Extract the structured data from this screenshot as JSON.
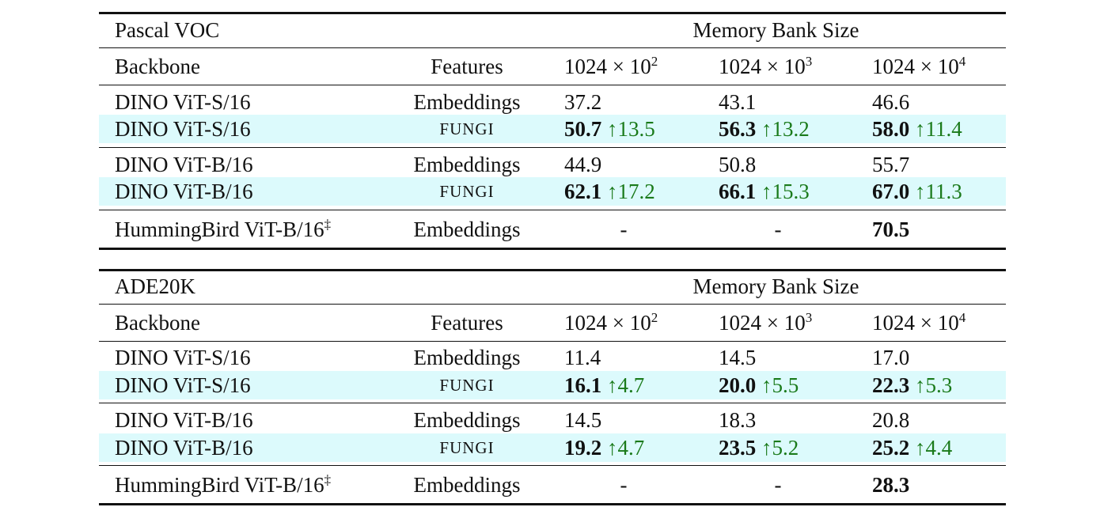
{
  "tables": [
    {
      "dataset": "Pascal VOC",
      "group_header": "Memory Bank Size",
      "columns": {
        "backbone": "Backbone",
        "features": "Features",
        "sizes": [
          {
            "base": "1024 × 10",
            "exp": "2"
          },
          {
            "base": "1024 × 10",
            "exp": "3"
          },
          {
            "base": "1024 × 10",
            "exp": "4"
          }
        ]
      },
      "rows": [
        {
          "backbone": "DINO ViT-S/16",
          "features": "Embeddings",
          "values": [
            "37.2",
            "43.1",
            "46.6"
          ]
        },
        {
          "backbone": "DINO ViT-S/16",
          "features": "FUNGI",
          "values": [
            "50.7",
            "56.3",
            "58.0"
          ],
          "deltas": [
            "↑13.5",
            "↑13.2",
            "↑11.4"
          ]
        },
        {
          "backbone": "DINO ViT-B/16",
          "features": "Embeddings",
          "values": [
            "44.9",
            "50.8",
            "55.7"
          ]
        },
        {
          "backbone": "DINO ViT-B/16",
          "features": "FUNGI",
          "values": [
            "62.1",
            "66.1",
            "67.0"
          ],
          "deltas": [
            "↑17.2",
            "↑15.3",
            "↑11.3"
          ]
        },
        {
          "backbone": "HummingBird ViT-B/16",
          "backbone_sup": "‡",
          "features": "Embeddings",
          "values": [
            "-",
            "-",
            "70.5"
          ]
        }
      ]
    },
    {
      "dataset": "ADE20K",
      "group_header": "Memory Bank Size",
      "columns": {
        "backbone": "Backbone",
        "features": "Features",
        "sizes": [
          {
            "base": "1024 × 10",
            "exp": "2"
          },
          {
            "base": "1024 × 10",
            "exp": "3"
          },
          {
            "base": "1024 × 10",
            "exp": "4"
          }
        ]
      },
      "rows": [
        {
          "backbone": "DINO ViT-S/16",
          "features": "Embeddings",
          "values": [
            "11.4",
            "14.5",
            "17.0"
          ]
        },
        {
          "backbone": "DINO ViT-S/16",
          "features": "FUNGI",
          "values": [
            "16.1",
            "20.0",
            "22.3"
          ],
          "deltas": [
            "↑4.7",
            "↑5.5",
            "↑5.3"
          ]
        },
        {
          "backbone": "DINO ViT-B/16",
          "features": "Embeddings",
          "values": [
            "14.5",
            "18.3",
            "20.8"
          ]
        },
        {
          "backbone": "DINO ViT-B/16",
          "features": "FUNGI",
          "values": [
            "19.2",
            "23.5",
            "25.2"
          ],
          "deltas": [
            "↑4.7",
            "↑5.2",
            "↑4.4"
          ]
        },
        {
          "backbone": "HummingBird ViT-B/16",
          "backbone_sup": "‡",
          "features": "Embeddings",
          "values": [
            "-",
            "-",
            "28.3"
          ]
        }
      ]
    }
  ],
  "colors": {
    "highlight_row": "#dcfafc",
    "delta_green": "#1a7a1a"
  }
}
